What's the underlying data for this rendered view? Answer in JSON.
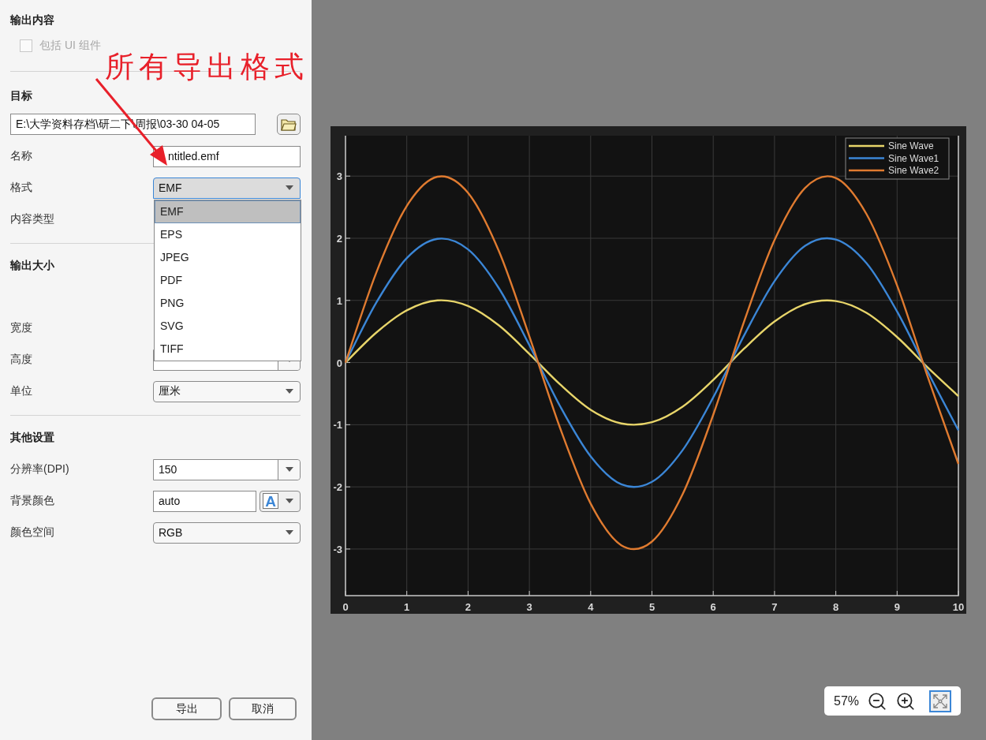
{
  "output_content": {
    "heading": "输出内容",
    "include_ui": {
      "label": "包括 UI 组件",
      "checked": false,
      "disabled": true
    }
  },
  "target": {
    "heading": "目标",
    "path": "E:\\大学资料存档\\研二下\\周报\\03-30 04-05",
    "name_label": "名称",
    "name_value": "ntitled.emf",
    "format_label": "格式",
    "format": {
      "value": "EMF",
      "expanded": true,
      "options": [
        {
          "label": "EMF",
          "selected": true
        },
        {
          "label": "EPS",
          "selected": false
        },
        {
          "label": "JPEG",
          "selected": false
        },
        {
          "label": "PDF",
          "selected": false
        },
        {
          "label": "PNG",
          "selected": false
        },
        {
          "label": "SVG",
          "selected": false
        },
        {
          "label": "TIFF",
          "selected": false
        }
      ]
    },
    "content_type_label": "内容类型"
  },
  "output_size": {
    "heading": "输出大小",
    "width_label": "宽度",
    "height_label": "高度",
    "units_label": "单位",
    "units": "厘米"
  },
  "other": {
    "heading": "其他设置",
    "dpi_label": "分辨率(DPI)",
    "dpi": "150",
    "bg_label": "背景颜色",
    "bg": "auto",
    "bg_glyph": "A",
    "colorspace_label": "颜色空间",
    "colorspace": "RGB"
  },
  "buttons": [
    {
      "label": "导出"
    },
    {
      "label": "取消"
    }
  ],
  "annotation": {
    "text": "所有导出格式"
  },
  "chart": {
    "chart_data": {
      "type": "line",
      "grid": true,
      "legend": true,
      "x": [
        0,
        0.5,
        1,
        1.5,
        2,
        2.5,
        3,
        3.5,
        4,
        4.5,
        5,
        5.5,
        6,
        6.5,
        7,
        7.5,
        8,
        8.5,
        9,
        9.5,
        10
      ],
      "xlim": [
        0,
        10
      ],
      "ylim": [
        -3.75,
        3.65
      ],
      "xticks": [
        0,
        1,
        2,
        3,
        4,
        5,
        6,
        7,
        8,
        9,
        10
      ],
      "yticks": [
        -3,
        -2,
        -1,
        0,
        1,
        2,
        3
      ],
      "series": [
        {
          "name": "Sine Wave",
          "color": "#e8d56a",
          "values": [
            0,
            0.48,
            0.84,
            1.0,
            0.91,
            0.6,
            0.14,
            -0.35,
            -0.76,
            -0.98,
            -0.96,
            -0.71,
            -0.28,
            0.22,
            0.66,
            0.94,
            0.99,
            0.8,
            0.41,
            -0.08,
            -0.54
          ]
        },
        {
          "name": "Sine Wave1",
          "color": "#3b86d6",
          "values": [
            0,
            0.96,
            1.68,
            1.99,
            1.82,
            1.2,
            0.28,
            -0.7,
            -1.51,
            -1.96,
            -1.92,
            -1.41,
            -0.56,
            0.43,
            1.31,
            1.88,
            1.98,
            1.6,
            0.82,
            -0.15,
            -1.09
          ]
        },
        {
          "name": "Sine Wave2",
          "color": "#e07b30",
          "values": [
            0,
            1.44,
            2.52,
            2.99,
            2.73,
            1.8,
            0.42,
            -1.05,
            -2.27,
            -2.94,
            -2.88,
            -2.12,
            -0.84,
            0.65,
            1.97,
            2.81,
            2.97,
            2.39,
            1.24,
            -0.23,
            -1.63
          ]
        }
      ]
    }
  },
  "zoom_bar": {
    "percent": "57%"
  }
}
